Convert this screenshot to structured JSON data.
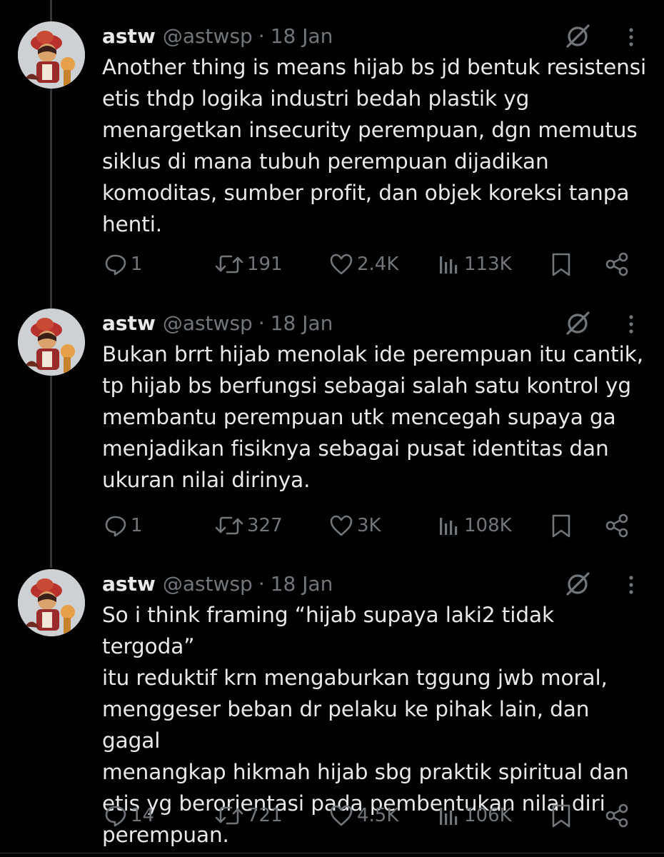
{
  "tweets": [
    {
      "name": "astw",
      "handle": "@astwsp",
      "dot": "·",
      "date": "18 Jan",
      "text": "Another thing is means hijab bs jd bentuk resistensi\netis thdp logika industri bedah plastik yg\nmenargetkan insecurity perempuan, dgn memutus\nsiklus di mana tubuh perempuan dijadikan\nkomoditas, sumber profit, dan objek koreksi tanpa\nhenti.",
      "replies": "1",
      "reposts": "191",
      "likes": "2.4K",
      "views": "113K"
    },
    {
      "name": "astw",
      "handle": "@astwsp",
      "dot": "·",
      "date": "18 Jan",
      "text": "Bukan brrt hijab menolak ide perempuan itu cantik,\ntp hijab bs berfungsi sebagai salah satu kontrol yg\nmembantu perempuan utk mencegah supaya ga\nmenjadikan fisiknya sebagai pusat identitas dan\nukuran nilai dirinya.",
      "replies": "1",
      "reposts": "327",
      "likes": "3K",
      "views": "108K"
    },
    {
      "name": "astw",
      "handle": "@astwsp",
      "dot": "·",
      "date": "18 Jan",
      "text": "So i think framing “hijab supaya laki2 tidak tergoda”\nitu reduktif krn mengaburkan tggung jwb moral,\nmenggeser beban dr pelaku ke pihak lain, dan gagal\nmenangkap hikmah hijab sbg praktik spiritual dan\netis yg berorientasi pada pembentukan nilai diri\nperempuan.",
      "replies": "14",
      "reposts": "721",
      "likes": "4.5K",
      "views": "106K"
    }
  ],
  "icons": {
    "reply": "reply-icon",
    "repost": "repost-icon",
    "like": "like-icon",
    "views": "views-icon",
    "bookmark": "bookmark-icon",
    "share": "share-icon",
    "grok": "grok-icon",
    "more": "more-icon"
  },
  "colors": {
    "background": "#000000",
    "text": "#e7e9ea",
    "muted": "#71767b",
    "thread_line": "#333639"
  }
}
